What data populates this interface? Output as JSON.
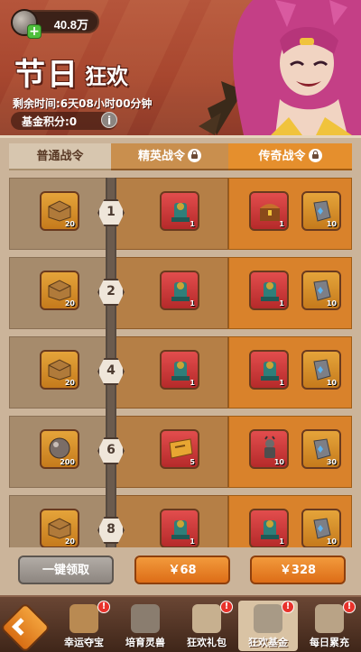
{
  "header": {
    "currency_amount": "40.8万",
    "title_main": "节日",
    "title_sub": "狂欢",
    "countdown": "剩余时间:6天08小时00分钟",
    "fund_points": "基金积分:0",
    "info": "i"
  },
  "tabs": [
    {
      "label": "普通战令",
      "locked": false
    },
    {
      "label": "精英战令",
      "locked": true
    },
    {
      "label": "传奇战令",
      "locked": true
    }
  ],
  "rows": [
    {
      "level": "1",
      "normal": {
        "icon": "box-icon",
        "count": "20"
      },
      "elite": {
        "icon": "statue-icon",
        "count": "1"
      },
      "legend": [
        {
          "icon": "treasure-chest-icon",
          "count": "1"
        },
        {
          "icon": "stone-icon",
          "count": "10"
        }
      ]
    },
    {
      "level": "2",
      "normal": {
        "icon": "box-icon",
        "count": "20"
      },
      "elite": {
        "icon": "statue-icon",
        "count": "1"
      },
      "legend": [
        {
          "icon": "statue-icon",
          "count": "1"
        },
        {
          "icon": "stone-icon",
          "count": "10"
        }
      ]
    },
    {
      "level": "4",
      "normal": {
        "icon": "box-icon",
        "count": "20"
      },
      "elite": {
        "icon": "statue-icon",
        "count": "1"
      },
      "legend": [
        {
          "icon": "statue-icon",
          "count": "1"
        },
        {
          "icon": "stone-icon",
          "count": "10"
        }
      ]
    },
    {
      "level": "6",
      "normal": {
        "icon": "orb-icon",
        "count": "200"
      },
      "elite": {
        "icon": "ticket-icon",
        "count": "5"
      },
      "legend": [
        {
          "icon": "warrior-icon",
          "count": "10"
        },
        {
          "icon": "stone-icon",
          "count": "30"
        }
      ]
    },
    {
      "level": "8",
      "normal": {
        "icon": "box-icon",
        "count": "20"
      },
      "elite": {
        "icon": "statue-icon",
        "count": "1"
      },
      "legend": [
        {
          "icon": "statue-icon",
          "count": "1"
        },
        {
          "icon": "stone-icon",
          "count": "10"
        }
      ]
    }
  ],
  "actions": {
    "claim_all": "一键领取",
    "price_elite": "￥68",
    "price_legend": "￥328"
  },
  "nav": [
    {
      "label": "幸运夺宝",
      "icon": "treasure-icon",
      "badge": "!",
      "active": false
    },
    {
      "label": "培育灵兽",
      "icon": "beast-icon",
      "badge": "",
      "active": false
    },
    {
      "label": "狂欢礼包",
      "icon": "gift-icon",
      "badge": "!",
      "active": false
    },
    {
      "label": "狂欢基金",
      "icon": "chart-icon",
      "badge": "!",
      "active": true
    },
    {
      "label": "每日累充",
      "icon": "money-bag-icon",
      "badge": "!",
      "active": false
    }
  ],
  "colors": {
    "header_bg": "#a8472f",
    "accent_orange": "#e58f2d",
    "panel_bg": "#cbb49a",
    "badge_red": "#e8322b"
  }
}
